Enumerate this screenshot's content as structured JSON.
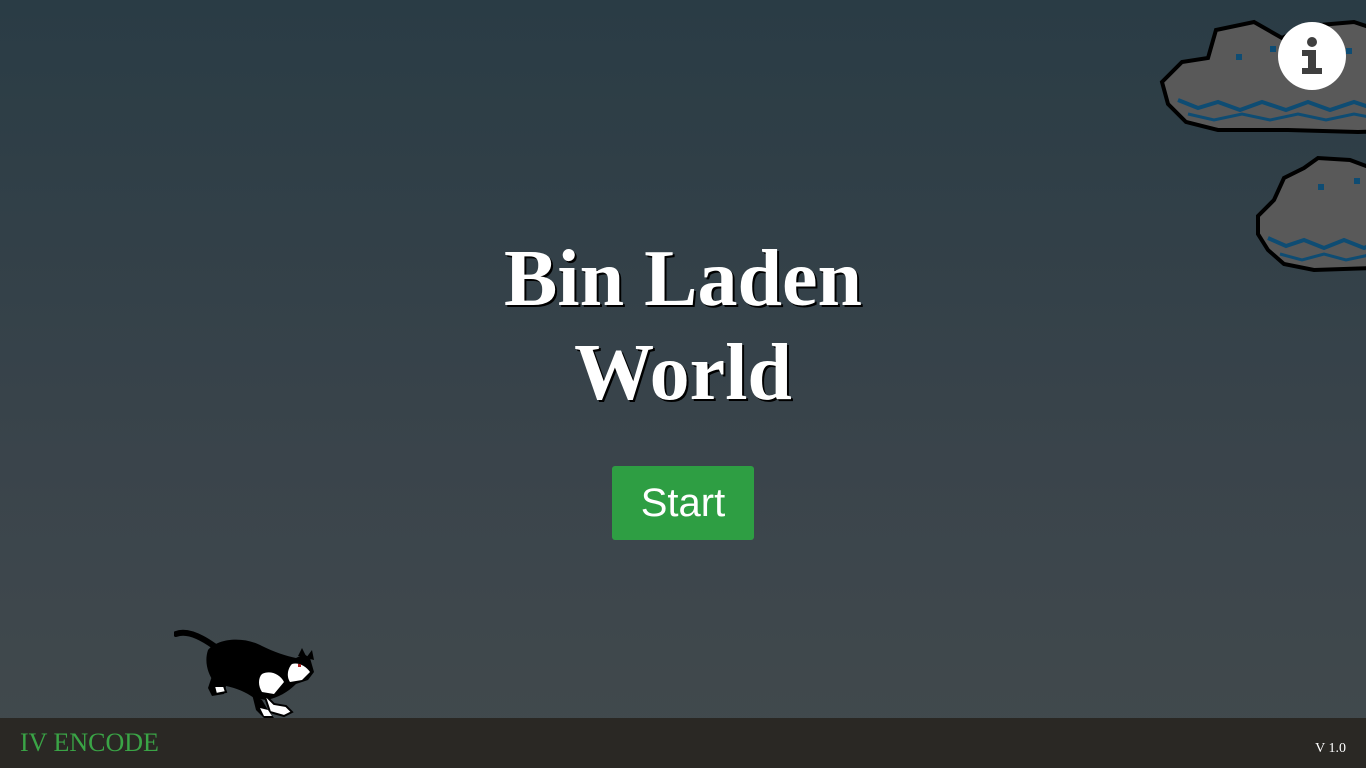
{
  "game": {
    "title_line_1": "Bin Laden",
    "title_line_2": "World",
    "start_label": "Start"
  },
  "footer": {
    "brand": "IV ENCODE",
    "version": "V 1.0"
  },
  "icons": {
    "info": "info-icon",
    "cloud": "cloud-icon",
    "cat": "cat-sprite"
  },
  "colors": {
    "background_top": "#2a3c45",
    "background_bottom": "#424a4d",
    "start_button": "#2e9e43",
    "brand_text": "#3aa446",
    "footer_bar": "#2a2824",
    "cloud_fill": "#595959",
    "cloud_accent": "#0e4c73"
  }
}
